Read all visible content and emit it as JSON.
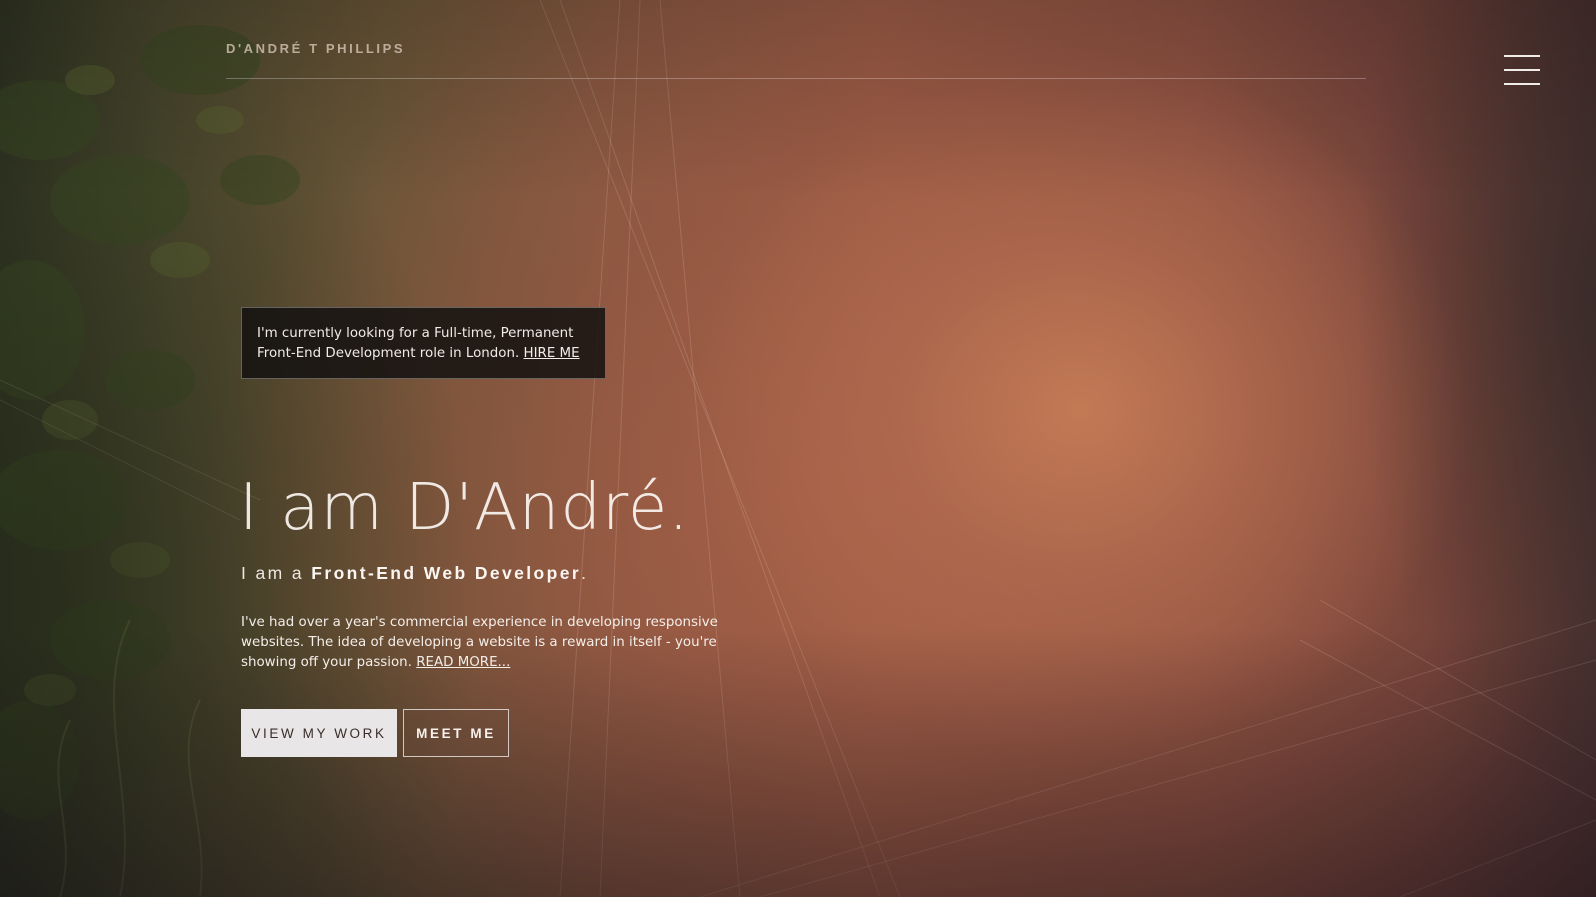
{
  "header": {
    "brand": "D'ANDRÉ T PHILLIPS",
    "menu_icon": "hamburger-menu-icon"
  },
  "notice": {
    "text": "I'm currently looking for a Full-time, Permanent Front-End Development role in London.",
    "link_label": "HIRE ME"
  },
  "hero": {
    "title": "I am D'André.",
    "sub_prefix": "I am a",
    "sub_role": "Front-End Web Developer",
    "sub_suffix": ".",
    "intro": "I've had over a year's commercial experience in developing responsive websites. The idea of developing a website is a reward in itself - you're showing off your passion.",
    "read_more": "READ MORE..."
  },
  "buttons": {
    "view_work": "VIEW MY WORK",
    "meet_me": "MEET ME"
  },
  "colors": {
    "primary_button_bg": "#e8e6e6",
    "notice_bg": "#141210",
    "text": "#f4ece6"
  }
}
